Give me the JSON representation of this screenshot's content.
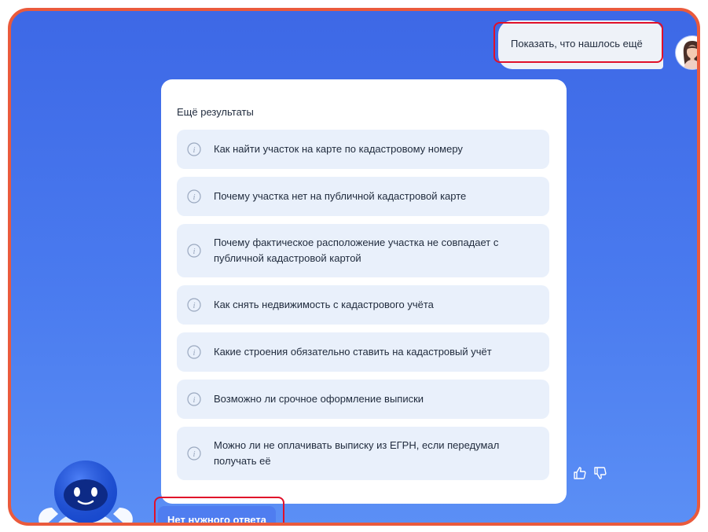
{
  "user_message": {
    "text": "Показать, что нашлось ещё"
  },
  "results_card": {
    "title": "Ещё результаты",
    "items": [
      {
        "label": "Как найти участок на карте по кадастровому номеру",
        "icon": "info-icon"
      },
      {
        "label": "Почему участка нет на публичной кадастровой карте",
        "icon": "info-icon"
      },
      {
        "label": "Почему фактическое расположение участка не совпадает с публичной кадастровой картой",
        "icon": "info-icon"
      },
      {
        "label": "Как снять недвижимость с кадастрового учёта",
        "icon": "info-icon"
      },
      {
        "label": "Какие строения обязательно ставить на кадастровый учёт",
        "icon": "info-icon"
      },
      {
        "label": "Возможно ли срочное оформление выписки",
        "icon": "info-icon"
      },
      {
        "label": "Можно ли не оплачивать выписку из ЕГРН, если передумал получать её",
        "icon": "info-icon"
      }
    ]
  },
  "feedback": {
    "like_icon": "thumbs-up-icon",
    "dislike_icon": "thumbs-down-icon"
  },
  "no_answer_button": {
    "label": "Нет нужного ответа"
  },
  "colors": {
    "background_top": "#3d68e6",
    "background_bottom": "#5b8ff5",
    "frame_border": "#ea5a3c",
    "highlight": "#e0102a",
    "item_background": "#e9f0fb",
    "button_background": "#4f7df0"
  }
}
